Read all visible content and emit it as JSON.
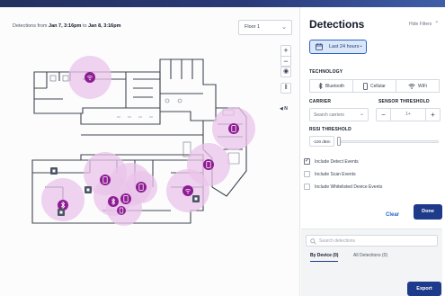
{
  "map": {
    "date_range": {
      "prefix": "Detections from",
      "start": "Jan 7, 3:16pm",
      "mid": "to",
      "end": "Jan 8, 3:16pm"
    },
    "floor": "Floor 1",
    "zoom_in": "+",
    "zoom_out": "−",
    "north": "N",
    "markers": [
      {
        "type": "wifi",
        "color": "#8e1c93"
      },
      {
        "type": "cellular",
        "color": "#8e1c93"
      },
      {
        "type": "cellular",
        "color": "#8e1c93"
      },
      {
        "type": "cellular",
        "color": "#8e1c93"
      },
      {
        "type": "wifi",
        "color": "#8e1c93"
      },
      {
        "type": "cellular",
        "color": "#8e1c93"
      },
      {
        "type": "cellular",
        "color": "#8e1c93"
      },
      {
        "type": "bluetooth",
        "color": "#8e1c93"
      },
      {
        "type": "bluetooth",
        "color": "#8e1c93"
      },
      {
        "type": "cellular",
        "color": "#8e1c93"
      },
      {
        "type": "sensor",
        "color": "#4b5563"
      },
      {
        "type": "sensor",
        "color": "#4b5563"
      },
      {
        "type": "sensor",
        "color": "#4b5563"
      },
      {
        "type": "sensor",
        "color": "#4b5563"
      }
    ]
  },
  "panel": {
    "title": "Detections",
    "hide_filters": "Hide Filters",
    "time_range": "Last 24 hours",
    "technology_label": "TECHNOLOGY",
    "technology": [
      {
        "label": "Bluetooth",
        "icon": "bluetooth-icon"
      },
      {
        "label": "Cellular",
        "icon": "cellular-icon"
      },
      {
        "label": "WiFi",
        "icon": "wifi-icon"
      }
    ],
    "carrier_label": "CARRIER",
    "carrier_placeholder": "Search carriers",
    "sensor_threshold_label": "SENSOR THRESHOLD",
    "sensor_threshold_value": "1+",
    "rssi_label": "RSSI THRESHOLD",
    "rssi_value": "-100 dBm",
    "checkboxes": [
      {
        "label": "Include Detect Events",
        "checked": true
      },
      {
        "label": "Include Scan Events",
        "checked": false
      },
      {
        "label": "Include Whitelisted Device Events",
        "checked": false
      }
    ],
    "clear": "Clear",
    "done": "Done",
    "search_placeholder": "Search detections",
    "tab_by_device": "By Device (0)",
    "tab_all": "All Detections (0)",
    "export": "Export"
  },
  "colors": {
    "accent": "#1e3a8a",
    "link": "#2b63c7",
    "marker": "#8e1c93",
    "marker_halo": "#e9c4ea"
  }
}
